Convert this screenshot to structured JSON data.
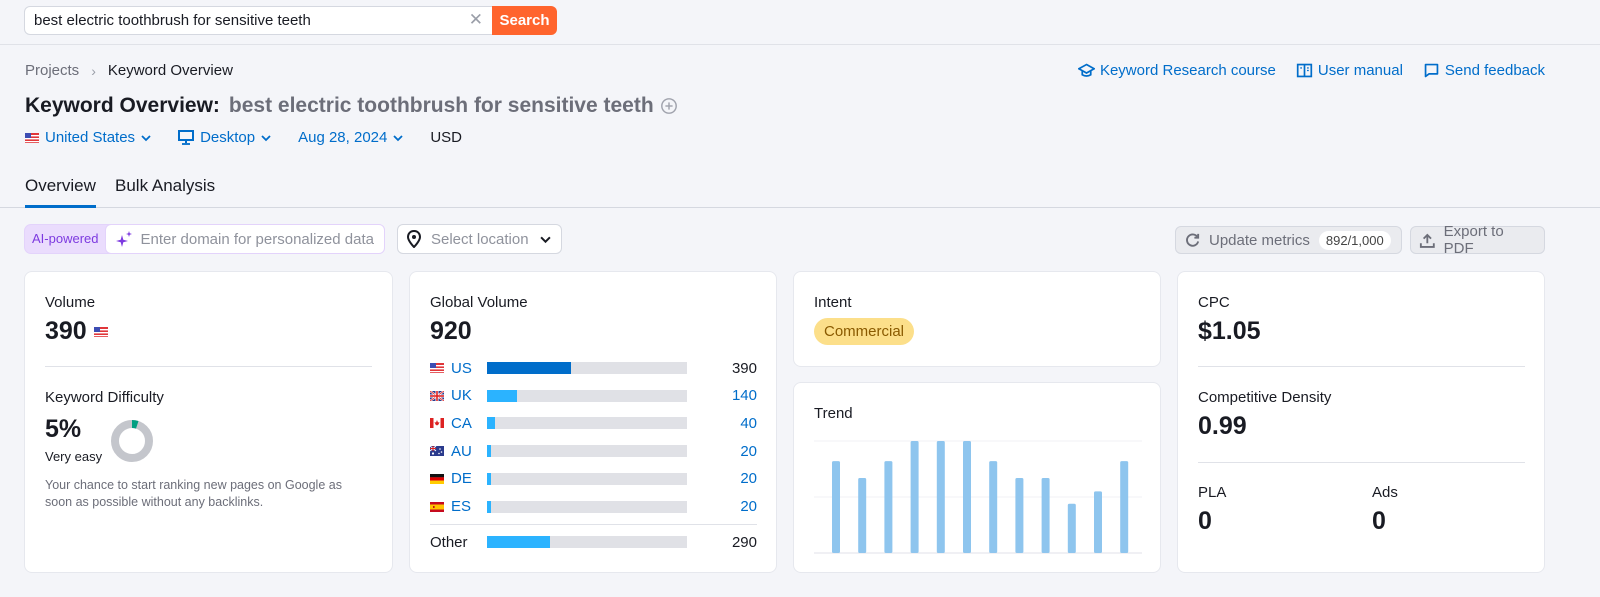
{
  "search": {
    "query": "best electric toothbrush for sensitive teeth",
    "clear_icon": "close-icon",
    "button_label": "Search"
  },
  "breadcrumb": {
    "items": [
      "Projects",
      "Keyword Overview"
    ]
  },
  "help_links": [
    {
      "icon": "graduation-cap-icon",
      "label": "Keyword Research course"
    },
    {
      "icon": "book-icon",
      "label": "User manual"
    },
    {
      "icon": "message-icon",
      "label": "Send feedback"
    }
  ],
  "title": {
    "prefix": "Keyword Overview:",
    "keyword": "best electric toothbrush for sensitive teeth"
  },
  "filters": {
    "country": "United States",
    "device": "Desktop",
    "date": "Aug 28, 2024",
    "currency": "USD"
  },
  "tabs": [
    {
      "label": "Overview",
      "active": true
    },
    {
      "label": "Bulk Analysis",
      "active": false
    }
  ],
  "toolbar": {
    "ai_label": "AI-powered",
    "domain_placeholder": "Enter domain for personalized data",
    "location_placeholder": "Select location",
    "update_label": "Update metrics",
    "update_counter": "892/1,000",
    "export_label": "Export to PDF"
  },
  "volume": {
    "label": "Volume",
    "value": "390"
  },
  "difficulty": {
    "label": "Keyword Difficulty",
    "value": "5%",
    "percent": 5,
    "level": "Very easy",
    "description": "Your chance to start ranking new pages on Google as soon as possible without any backlinks.",
    "color": "#009f81"
  },
  "global_volume": {
    "label": "Global Volume",
    "value": "920",
    "rows": [
      {
        "code": "US",
        "value": "390",
        "share": 0.42,
        "color": "#006dca",
        "linked": false
      },
      {
        "code": "UK",
        "value": "140",
        "share": 0.15,
        "color": "#2bb3ff",
        "linked": true
      },
      {
        "code": "CA",
        "value": "40",
        "share": 0.04,
        "color": "#2bb3ff",
        "linked": true
      },
      {
        "code": "AU",
        "value": "20",
        "share": 0.02,
        "color": "#2bb3ff",
        "linked": true
      },
      {
        "code": "DE",
        "value": "20",
        "share": 0.02,
        "color": "#2bb3ff",
        "linked": true
      },
      {
        "code": "ES",
        "value": "20",
        "share": 0.02,
        "color": "#2bb3ff",
        "linked": true
      }
    ],
    "other": {
      "label": "Other",
      "value": "290",
      "share": 0.315,
      "color": "#2bb3ff"
    }
  },
  "intent": {
    "label": "Intent",
    "value": "Commercial"
  },
  "trend": {
    "label": "Trend",
    "values": [
      0.82,
      0.67,
      0.82,
      1.0,
      1.0,
      1.0,
      0.82,
      0.67,
      0.67,
      0.44,
      0.55,
      0.82
    ],
    "color": "#8ec5ee"
  },
  "cpc": {
    "label": "CPC",
    "value": "$1.05"
  },
  "competitive_density": {
    "label": "Competitive Density",
    "value": "0.99"
  },
  "pla": {
    "label": "PLA",
    "value": "0"
  },
  "ads": {
    "label": "Ads",
    "value": "0"
  }
}
